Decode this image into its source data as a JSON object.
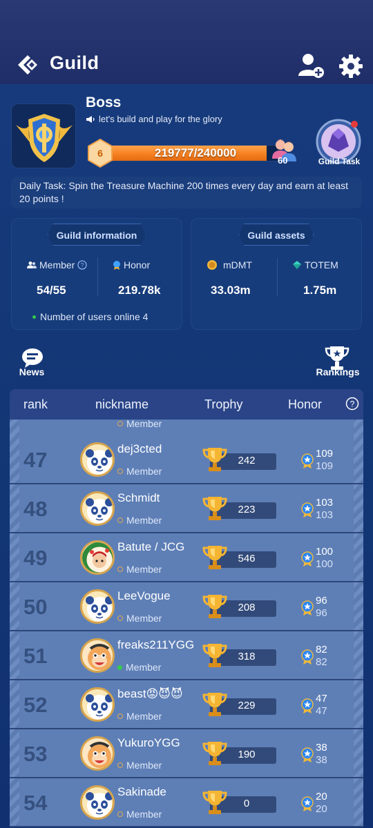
{
  "header": {
    "title": "Guild"
  },
  "guild": {
    "name": "Boss",
    "slogan": "let's build and play for the glory",
    "level": "6",
    "progress_text": "219777/240000",
    "progress_fraction": 0.9157,
    "member_count_badge": "60",
    "task_button_label": "Guild Task",
    "daily_task": "Daily Task: Spin the Treasure Machine 200 times every day and earn at least 20 points !"
  },
  "info_panel": {
    "tab": "Guild information",
    "member_label": "Member",
    "member_value": "54/55",
    "honor_label": "Honor",
    "honor_value": "219.78k",
    "online_text": "Number of users online 4"
  },
  "assets_panel": {
    "tab": "Guild assets",
    "mdmt_label": "mDMT",
    "mdmt_value": "33.03m",
    "totem_label": "TOTEM",
    "totem_value": "1.75m"
  },
  "actions": {
    "news": "News",
    "rankings": "Rankings"
  },
  "table": {
    "headers": [
      "rank",
      "nickname",
      "Trophy",
      "Honor"
    ],
    "partial_row": {
      "role": "Member"
    },
    "rows": [
      {
        "rank": "47",
        "nickname": "dej3cted",
        "role": "Member",
        "online": false,
        "trophy": "242",
        "honor": "109",
        "honor2": "109",
        "avatar": "panda"
      },
      {
        "rank": "48",
        "nickname": "Schmidt",
        "role": "Member",
        "online": false,
        "trophy": "223",
        "honor": "103",
        "honor2": "103",
        "avatar": "panda"
      },
      {
        "rank": "49",
        "nickname": "Batute / JCG",
        "role": "Member",
        "online": false,
        "trophy": "546",
        "honor": "100",
        "honor2": "100",
        "avatar": "wreath"
      },
      {
        "rank": "50",
        "nickname": "LeeVogue",
        "role": "Member",
        "online": false,
        "trophy": "208",
        "honor": "96",
        "honor2": "96",
        "avatar": "panda"
      },
      {
        "rank": "51",
        "nickname": "freaks211YGG",
        "role": "Member",
        "online": true,
        "trophy": "318",
        "honor": "82",
        "honor2": "82",
        "avatar": "monkey"
      },
      {
        "rank": "52",
        "nickname": "beast😡😈😈",
        "role": "Member",
        "online": false,
        "trophy": "229",
        "honor": "47",
        "honor2": "47",
        "avatar": "panda"
      },
      {
        "rank": "53",
        "nickname": "YukuroYGG",
        "role": "Member",
        "online": false,
        "trophy": "190",
        "honor": "38",
        "honor2": "38",
        "avatar": "monkey"
      },
      {
        "rank": "54",
        "nickname": "Sakinade",
        "role": "Member",
        "online": false,
        "trophy": "0",
        "honor": "20",
        "honor2": "20",
        "avatar": "panda"
      }
    ]
  },
  "colors": {
    "accent_orange": "#f57e1f",
    "panel_blue": "#173c7b",
    "row_blue": "#5e7fb6",
    "online_green": "#35c94d"
  }
}
